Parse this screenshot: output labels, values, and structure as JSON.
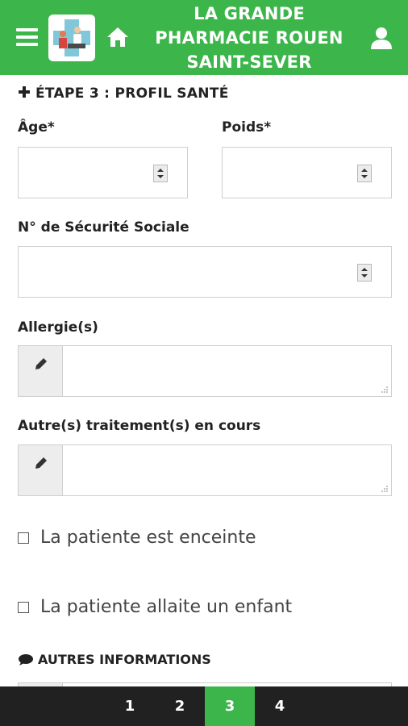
{
  "header": {
    "title": "LA GRANDE\nPHARMACIE ROUEN\nSAINT-SEVER",
    "menu_icon": "hamburger-icon",
    "home_icon": "home-icon",
    "user_icon": "user-icon",
    "brand_color": "#3cb54a"
  },
  "form": {
    "step_title": "ÉTAPE 3 : PROFIL SANTÉ",
    "age_label": "Âge*",
    "age_value": "",
    "poids_label": "Poids*",
    "poids_value": "",
    "secu_label": "N° de Sécurité Sociale",
    "secu_value": "",
    "allergies_label": "Allergie(s)",
    "allergies_value": "",
    "traitements_label": "Autre(s) traitement(s) en cours",
    "traitements_value": "",
    "enceinte_label": "La patiente est enceinte",
    "enceinte_checked": false,
    "allaite_label": "La patiente allaite un enfant",
    "allaite_checked": false,
    "autres_title": "AUTRES INFORMATIONS"
  },
  "pager": {
    "pages": [
      "1",
      "2",
      "3",
      "4"
    ],
    "active": "3"
  }
}
